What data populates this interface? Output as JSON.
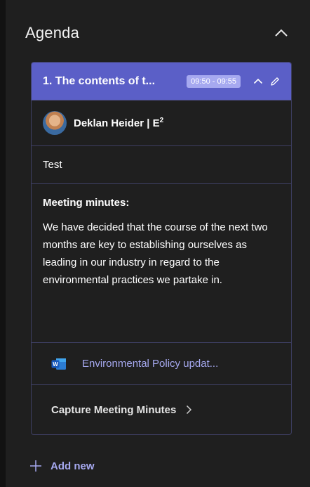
{
  "header": {
    "title": "Agenda"
  },
  "agenda_item": {
    "title": "1. The contents of t...",
    "time": "09:50 - 09:55",
    "presenter": {
      "name": "Deklan Heider | E",
      "superscript": "2"
    },
    "description": "Test",
    "minutes_label": "Meeting minutes:",
    "minutes_text": "We have decided that the course of the next two months are key to establishing ourselves as leading in our industry in regard to the environmental practices we partake in.",
    "attachment": {
      "name": "Environmental Policy updat...",
      "icon": "word-file-icon",
      "app_letter": "W"
    },
    "capture_label": "Capture Meeting Minutes"
  },
  "add_new_label": "Add new",
  "colors": {
    "accent": "#5b5fc7",
    "accent_light": "#a6a9f0",
    "background": "#1f1f1f",
    "border": "#3e3f63"
  }
}
